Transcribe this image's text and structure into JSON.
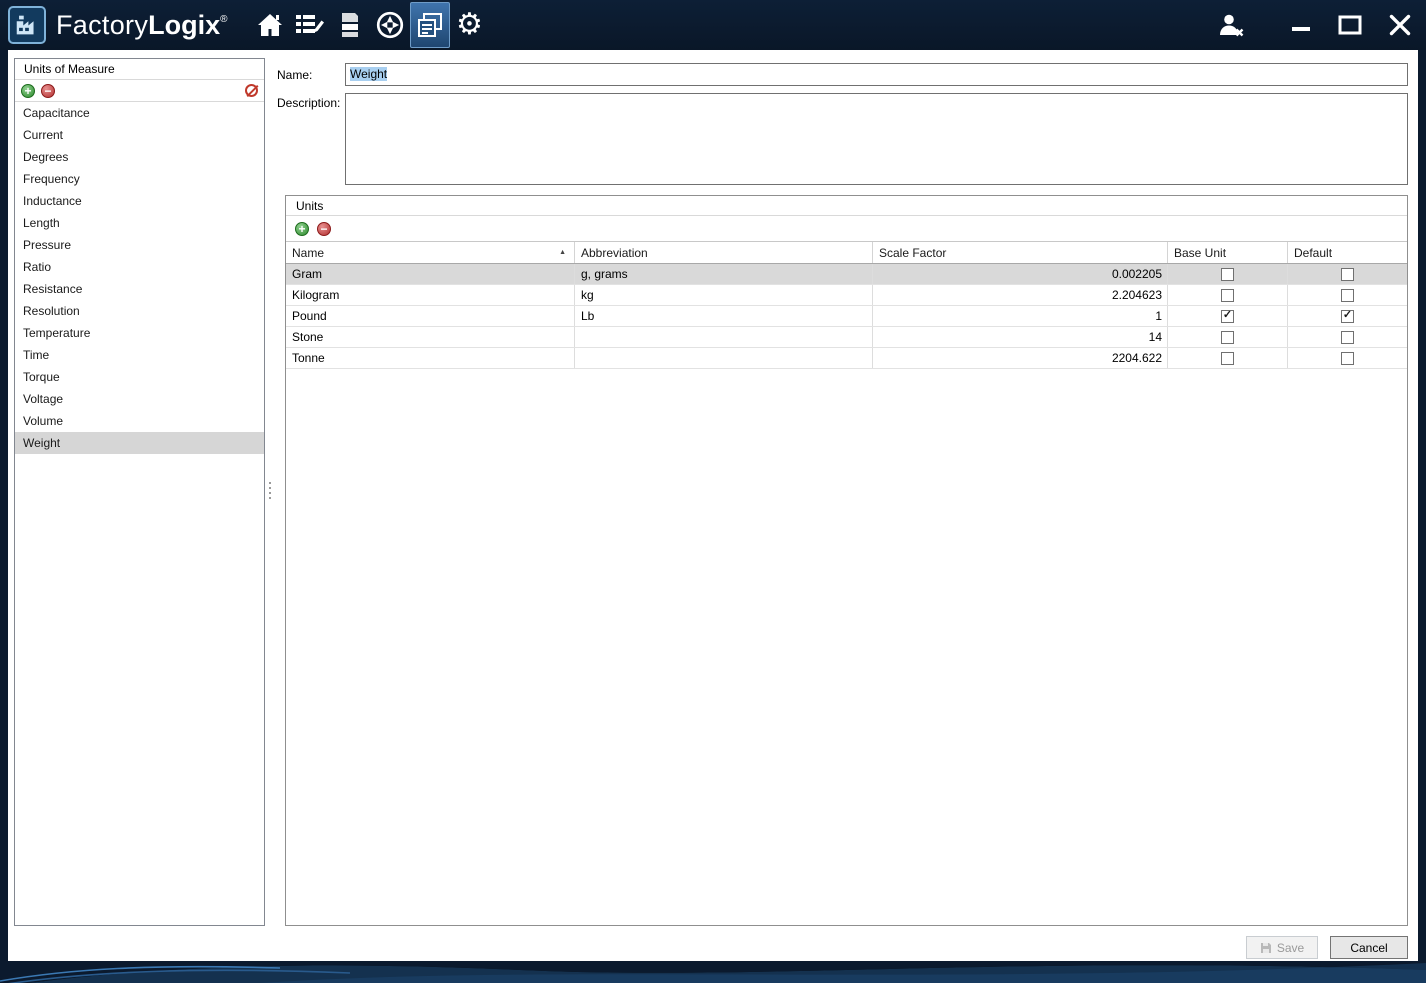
{
  "titlebar": {
    "app_name_light": "Factory",
    "app_name_bold": "Logix",
    "registered": "®"
  },
  "sidebar": {
    "title": "Units of Measure",
    "items": [
      "Capacitance",
      "Current",
      "Degrees",
      "Frequency",
      "Inductance",
      "Length",
      "Pressure",
      "Ratio",
      "Resistance",
      "Resolution",
      "Temperature",
      "Time",
      "Torque",
      "Voltage",
      "Volume",
      "Weight"
    ],
    "selected": "Weight"
  },
  "form": {
    "name_label": "Name:",
    "name_value": "Weight",
    "description_label": "Description:",
    "description_value": ""
  },
  "units": {
    "group_title": "Units",
    "columns": [
      "Name",
      "Abbreviation",
      "Scale Factor",
      "Base Unit",
      "Default"
    ],
    "sort_column": "Name",
    "sort_direction": "ascending",
    "sort_glyph": "▲",
    "rows": [
      {
        "name": "Gram",
        "abbreviation": "g, grams",
        "scale_factor": "0.002205",
        "base_unit": false,
        "default": false,
        "selected": true
      },
      {
        "name": "Kilogram",
        "abbreviation": "kg",
        "scale_factor": "2.204623",
        "base_unit": false,
        "default": false,
        "selected": false
      },
      {
        "name": "Pound",
        "abbreviation": "Lb",
        "scale_factor": "1",
        "base_unit": true,
        "default": true,
        "selected": false
      },
      {
        "name": "Stone",
        "abbreviation": "",
        "scale_factor": "14",
        "base_unit": false,
        "default": false,
        "selected": false
      },
      {
        "name": "Tonne",
        "abbreviation": "",
        "scale_factor": "2204.622",
        "base_unit": false,
        "default": false,
        "selected": false
      }
    ]
  },
  "footer": {
    "save_label": "Save",
    "cancel_label": "Cancel"
  },
  "colors": {
    "titlebar_bg": "#0b1a2e",
    "active_tab_bg": "#2d5b8e",
    "row_selection_bg": "#d9d9d9",
    "text_selection_bg": "#a8cff0",
    "add_icon_green": "#2e8b2e",
    "remove_icon_red": "#b23030"
  }
}
